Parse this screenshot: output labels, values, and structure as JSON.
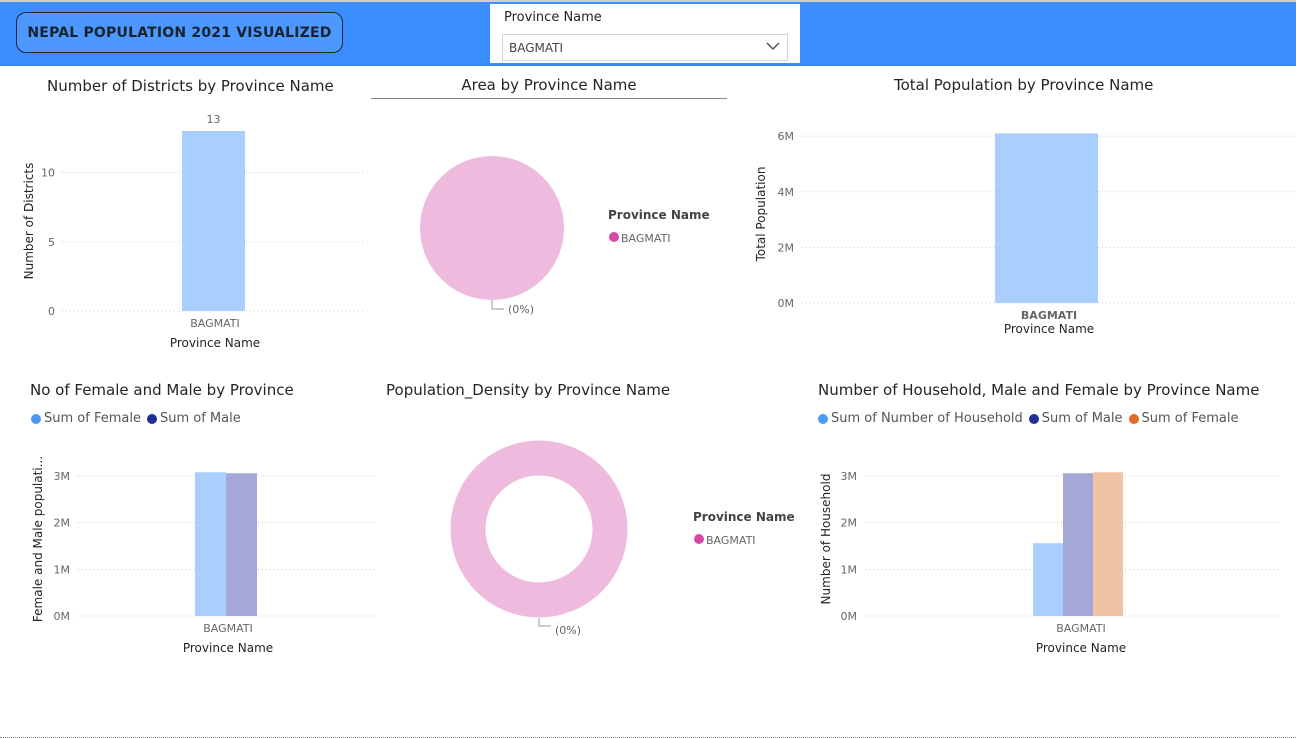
{
  "header": {
    "title": "NEPAL POPULATION 2021 VISUALIZED",
    "slicer_label": "Province Name",
    "slicer_value": "BAGMATI"
  },
  "colors": {
    "topbar": "#3a8eff",
    "light_blue": "#aacfff",
    "female_blue": "#4a9af5",
    "male_navy": "#1f2f99",
    "male_bar": "#a3a8d6",
    "female_orange": "#e06a2a",
    "female_bar": "#f0c3a5",
    "pink": "#eebadd",
    "legend_pink": "#d64aa6"
  },
  "charts": {
    "districts": {
      "title": "Number of Districts by Province Name",
      "xlabel": "Province Name",
      "ylabel": "Number of Districts"
    },
    "area": {
      "title": "Area by Province Name",
      "legend_title": "Province Name",
      "legend_item": "BAGMATI",
      "slice_label": "(0%)"
    },
    "population": {
      "title": "Total Population by Province Name",
      "xlabel": "Province Name",
      "ylabel": "Total Population"
    },
    "gender": {
      "title": "No of Female and Male by Province",
      "xlabel": "Province Name",
      "ylabel": "Female and Male populati...",
      "legend": [
        "Sum of Female",
        "Sum of Male"
      ]
    },
    "density": {
      "title": "Population_Density by Province Name",
      "legend_title": "Province Name",
      "legend_item": "BAGMATI",
      "slice_label": "(0%)"
    },
    "household": {
      "title": "Number of Household, Male and Female by Province Name",
      "xlabel": "Province Name",
      "ylabel": "Number of Household",
      "legend": [
        "Sum of Number of Household",
        "Sum of Male",
        "Sum of Female"
      ]
    }
  },
  "chart_data": [
    {
      "type": "bar",
      "title": "Number of Districts by Province Name",
      "categories": [
        "BAGMATI"
      ],
      "values": [
        13
      ],
      "data_labels": [
        "13"
      ],
      "ylim": [
        0,
        13
      ],
      "yticks": [
        0,
        5,
        10
      ],
      "ytick_labels": [
        "0",
        "5",
        "10"
      ],
      "xlabel": "Province Name",
      "ylabel": "Number of Districts",
      "grid": true
    },
    {
      "type": "pie",
      "title": "Area by Province Name",
      "categories": [
        "BAGMATI"
      ],
      "values": [
        1
      ],
      "slice_label": "(0%)",
      "legend_title": "Province Name",
      "legend_position": "right"
    },
    {
      "type": "bar",
      "title": "Total Population by Province Name",
      "categories": [
        "BAGMATI"
      ],
      "values": [
        6100000
      ],
      "ylim": [
        0,
        6400000
      ],
      "yticks": [
        0,
        2000000,
        4000000,
        6000000
      ],
      "ytick_labels": [
        "0M",
        "2M",
        "4M",
        "6M"
      ],
      "xlabel": "Province Name",
      "ylabel": "Total Population",
      "grid": true
    },
    {
      "type": "bar",
      "title": "No of Female and Male by Province",
      "categories": [
        "BAGMATI"
      ],
      "series": [
        {
          "name": "Sum of Female",
          "values": [
            3080000
          ]
        },
        {
          "name": "Sum of Male",
          "values": [
            3060000
          ]
        }
      ],
      "ylim": [
        0,
        3300000
      ],
      "yticks": [
        0,
        1000000,
        2000000,
        3000000
      ],
      "ytick_labels": [
        "0M",
        "1M",
        "2M",
        "3M"
      ],
      "xlabel": "Province Name",
      "ylabel": "Female and Male populati...",
      "legend_position": "top-left",
      "grid": true
    },
    {
      "type": "pie",
      "title": "Population_Density by Province Name",
      "categories": [
        "BAGMATI"
      ],
      "values": [
        1
      ],
      "slice_label": "(0%)",
      "legend_title": "Province Name",
      "legend_position": "right"
    },
    {
      "type": "bar",
      "title": "Number of Household, Male and Female by Province Name",
      "categories": [
        "BAGMATI"
      ],
      "series": [
        {
          "name": "Sum of Number of Household",
          "values": [
            1560000
          ]
        },
        {
          "name": "Sum of Male",
          "values": [
            3060000
          ]
        },
        {
          "name": "Sum of Female",
          "values": [
            3080000
          ]
        }
      ],
      "ylim": [
        0,
        3300000
      ],
      "yticks": [
        0,
        1000000,
        2000000,
        3000000
      ],
      "ytick_labels": [
        "0M",
        "1M",
        "2M",
        "3M"
      ],
      "xlabel": "Province Name",
      "ylabel": "Number of Household",
      "legend_position": "top-left",
      "grid": true
    }
  ]
}
